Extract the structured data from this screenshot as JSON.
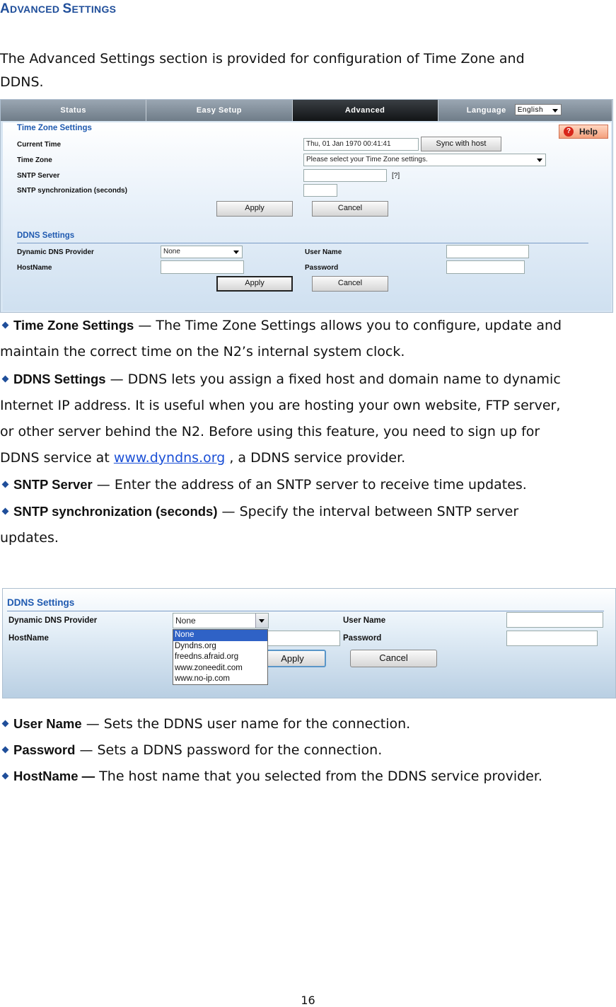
{
  "heading": {
    "first_cap": "A",
    "first_rest": "DVANCED",
    "second_cap": "S",
    "second_rest": "ETTINGS"
  },
  "intro": {
    "line1": "The Advanced Settings section is provided for configuration of Time Zone and",
    "line2": "DDNS."
  },
  "screenshot1": {
    "nav": {
      "status": "Status",
      "easy_setup": "Easy Setup",
      "advanced": "Advanced",
      "language_label": "Language",
      "language_value": "English"
    },
    "help_label": "Help",
    "timezone": {
      "title": "Time Zone Settings",
      "current_time_label": "Current Time",
      "current_time_value": "Thu, 01 Jan 1970 00:41:41",
      "sync_button": "Sync with host",
      "time_zone_label": "Time Zone",
      "time_zone_value": "Please select your Time Zone settings.",
      "sntp_server_label": "SNTP Server",
      "sntp_server_value": "",
      "sntp_hint": "[?]",
      "sntp_sync_label": "SNTP synchronization (seconds)",
      "sntp_sync_value": "",
      "apply": "Apply",
      "cancel": "Cancel"
    },
    "ddns": {
      "title": "DDNS Settings",
      "provider_label": "Dynamic DNS Provider",
      "provider_value": "None",
      "username_label": "User Name",
      "hostname_label": "HostName",
      "password_label": "Password",
      "apply": "Apply",
      "cancel": "Cancel"
    }
  },
  "bullets1": {
    "tz_term": "Time Zone Settings",
    "tz_text1": " — The Time Zone Settings allows you to configure, update and",
    "tz_text2": "maintain the correct time on the N2’s internal system clock.",
    "ddns_term": "DDNS Settings",
    "ddns_text1": " — DDNS lets you assign a fixed host and domain name to dynamic",
    "ddns_text2": "Internet IP address. It is useful when you are hosting your own website, FTP server,",
    "ddns_text3": "or other server behind the N2. Before using this feature, you need to sign up for",
    "ddns_text4_pre": "DDNS service at ",
    "ddns_link": "www.dyndns.org",
    "ddns_text4_post": " , a DDNS service provider.",
    "sntp_term": "SNTP Server",
    "sntp_text": " — Enter the address of an SNTP server to receive time updates.",
    "sync_term": "SNTP synchronization (seconds)",
    "sync_text1": " — Specify the interval between SNTP server",
    "sync_text2": "updates."
  },
  "screenshot2": {
    "title": "DDNS Settings",
    "provider_label": "Dynamic DNS Provider",
    "provider_value": "None",
    "options": [
      "None",
      "Dyndns.org",
      "freedns.afraid.org",
      "www.zoneedit.com",
      "www.no-ip.com"
    ],
    "username_label": "User Name",
    "hostname_label": "HostName",
    "password_label": "Password",
    "apply": "Apply",
    "cancel": "Cancel"
  },
  "bullets2": {
    "user_term": "User Name",
    "user_text": " — Sets the DDNS user name for the connection.",
    "pass_term": "Password",
    "pass_text": " — Sets a DDNS password for the connection.",
    "host_term": "HostName —",
    "host_text": " The host name that you selected from the DDNS service provider."
  },
  "page_number": "16"
}
